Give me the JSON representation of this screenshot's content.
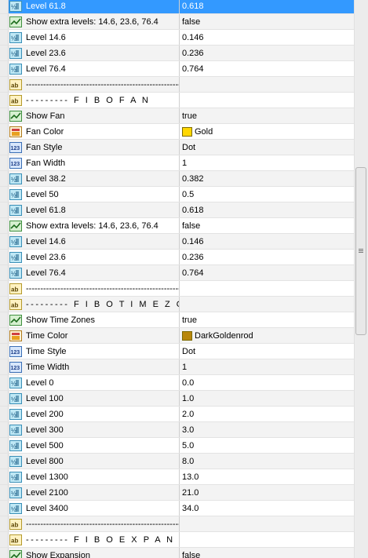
{
  "colors": {
    "selection": "#3399ff",
    "gold": "#ffd700",
    "darkgoldenrod": "#b8860b"
  },
  "rows": [
    {
      "icon": "num-real",
      "name": "Level 61.8",
      "value": "0.618",
      "selected": true
    },
    {
      "icon": "bool",
      "name": "Show extra levels: 14.6, 23.6, 76.4",
      "value": "false"
    },
    {
      "icon": "num-real",
      "name": "Level 14.6",
      "value": "0.146"
    },
    {
      "icon": "num-real",
      "name": "Level 23.6",
      "value": "0.236"
    },
    {
      "icon": "num-real",
      "name": "Level 76.4",
      "value": "0.764"
    },
    {
      "icon": "text",
      "name": "--------------------------------------------------------",
      "value": ""
    },
    {
      "icon": "text",
      "name": "--------- F I B O   F A N",
      "value": "",
      "section": true
    },
    {
      "icon": "bool",
      "name": "Show Fan",
      "value": "true"
    },
    {
      "icon": "color",
      "name": "Fan Color",
      "value": "Gold",
      "swatch": "#ffd700"
    },
    {
      "icon": "num-int",
      "name": "Fan Style",
      "value": "Dot"
    },
    {
      "icon": "num-int",
      "name": "Fan Width",
      "value": "1"
    },
    {
      "icon": "num-real",
      "name": "Level 38.2",
      "value": "0.382"
    },
    {
      "icon": "num-real",
      "name": "Level 50",
      "value": "0.5"
    },
    {
      "icon": "num-real",
      "name": "Level 61.8",
      "value": "0.618"
    },
    {
      "icon": "bool",
      "name": "Show extra levels: 14.6, 23.6, 76.4",
      "value": "false"
    },
    {
      "icon": "num-real",
      "name": "Level 14.6",
      "value": "0.146"
    },
    {
      "icon": "num-real",
      "name": "Level 23.6",
      "value": "0.236"
    },
    {
      "icon": "num-real",
      "name": "Level 76.4",
      "value": "0.764"
    },
    {
      "icon": "text",
      "name": "--------------------------------------------------------",
      "value": ""
    },
    {
      "icon": "text",
      "name": "--------- F I B O   T I M E Z O N E S",
      "value": "",
      "section": true
    },
    {
      "icon": "bool",
      "name": "Show Time Zones",
      "value": "true"
    },
    {
      "icon": "color",
      "name": "Time Color",
      "value": "DarkGoldenrod",
      "swatch": "#b8860b"
    },
    {
      "icon": "num-int",
      "name": "Time Style",
      "value": "Dot"
    },
    {
      "icon": "num-int",
      "name": "Time Width",
      "value": "1"
    },
    {
      "icon": "num-real",
      "name": "Level 0",
      "value": "0.0"
    },
    {
      "icon": "num-real",
      "name": "Level 100",
      "value": "1.0"
    },
    {
      "icon": "num-real",
      "name": "Level 200",
      "value": "2.0"
    },
    {
      "icon": "num-real",
      "name": "Level 300",
      "value": "3.0"
    },
    {
      "icon": "num-real",
      "name": "Level 500",
      "value": "5.0"
    },
    {
      "icon": "num-real",
      "name": "Level 800",
      "value": "8.0"
    },
    {
      "icon": "num-real",
      "name": "Level 1300",
      "value": "13.0"
    },
    {
      "icon": "num-real",
      "name": "Level 2100",
      "value": "21.0"
    },
    {
      "icon": "num-real",
      "name": "Level 3400",
      "value": "34.0"
    },
    {
      "icon": "text",
      "name": "--------------------------------------------------------",
      "value": ""
    },
    {
      "icon": "text",
      "name": "--------- F I B O   E X P A N S I O N",
      "value": "",
      "section": true
    },
    {
      "icon": "bool",
      "name": "Show Expansion",
      "value": "false"
    }
  ]
}
